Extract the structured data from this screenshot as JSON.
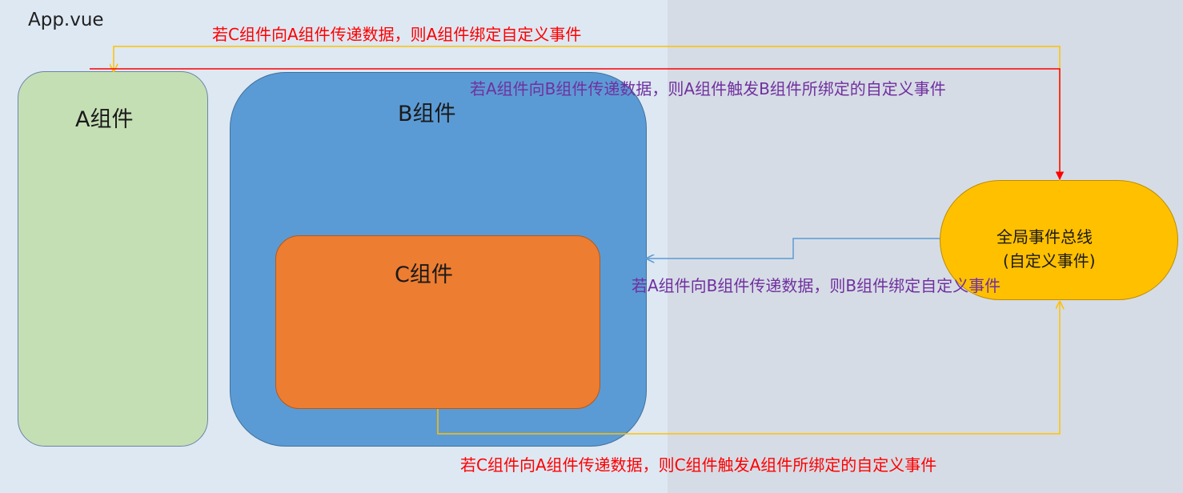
{
  "diagram": {
    "app_title": "App.vue",
    "components": {
      "a": "A组件",
      "b": "B组件",
      "c": "C组件"
    },
    "bus": {
      "line1": "全局事件总线",
      "line2": "(自定义事件)"
    },
    "notes": {
      "c_to_a_bind": "若C组件向A组件传递数据，则A组件绑定自定义事件",
      "a_to_b_emit": "若A组件向B组件传递数据，则A组件触发B组件所绑定的自定义事件",
      "a_to_b_bind": "若A组件向B组件传递数据，则B组件绑定自定义事件",
      "c_to_a_emit": "若C组件向A组件传递数据，则C组件触发A组件所绑定的自定义事件"
    },
    "colors": {
      "app_background": "#dde8f3",
      "outside_background": "#d6dce5",
      "component_a": "#c5dfb4",
      "component_b": "#5b9bd5",
      "component_c": "#ed7d31",
      "event_bus": "#ffc000",
      "red_note": "#ff0000",
      "purple_note": "#7030a0",
      "yellow_arrow": "#ffc000",
      "red_arrow": "#ff0000",
      "blue_arrow": "#5b9bd5"
    }
  }
}
